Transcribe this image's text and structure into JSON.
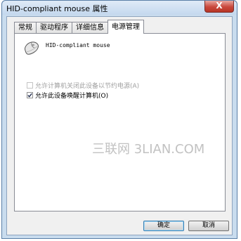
{
  "window": {
    "title": "HID-compliant mouse 属性",
    "close_label": "X"
  },
  "tabs": [
    {
      "label": "常规"
    },
    {
      "label": "驱动程序"
    },
    {
      "label": "详细信息"
    },
    {
      "label": "电源管理"
    }
  ],
  "panel": {
    "device_name": "HID-compliant mouse",
    "options": [
      {
        "label": "允许计算机关闭此设备以节约电源(A)",
        "checked": false,
        "enabled": false
      },
      {
        "label": "允许此设备唤醒计算机(O)",
        "checked": true,
        "enabled": true
      }
    ]
  },
  "watermark": "三联网 3LIAN.COM",
  "buttons": {
    "ok_label": "确定",
    "cancel_label": "取消"
  },
  "colors": {
    "title_bar": "#c4d8ee",
    "close_button": "#c9483c",
    "default_button_border": "#3c7fb1"
  }
}
